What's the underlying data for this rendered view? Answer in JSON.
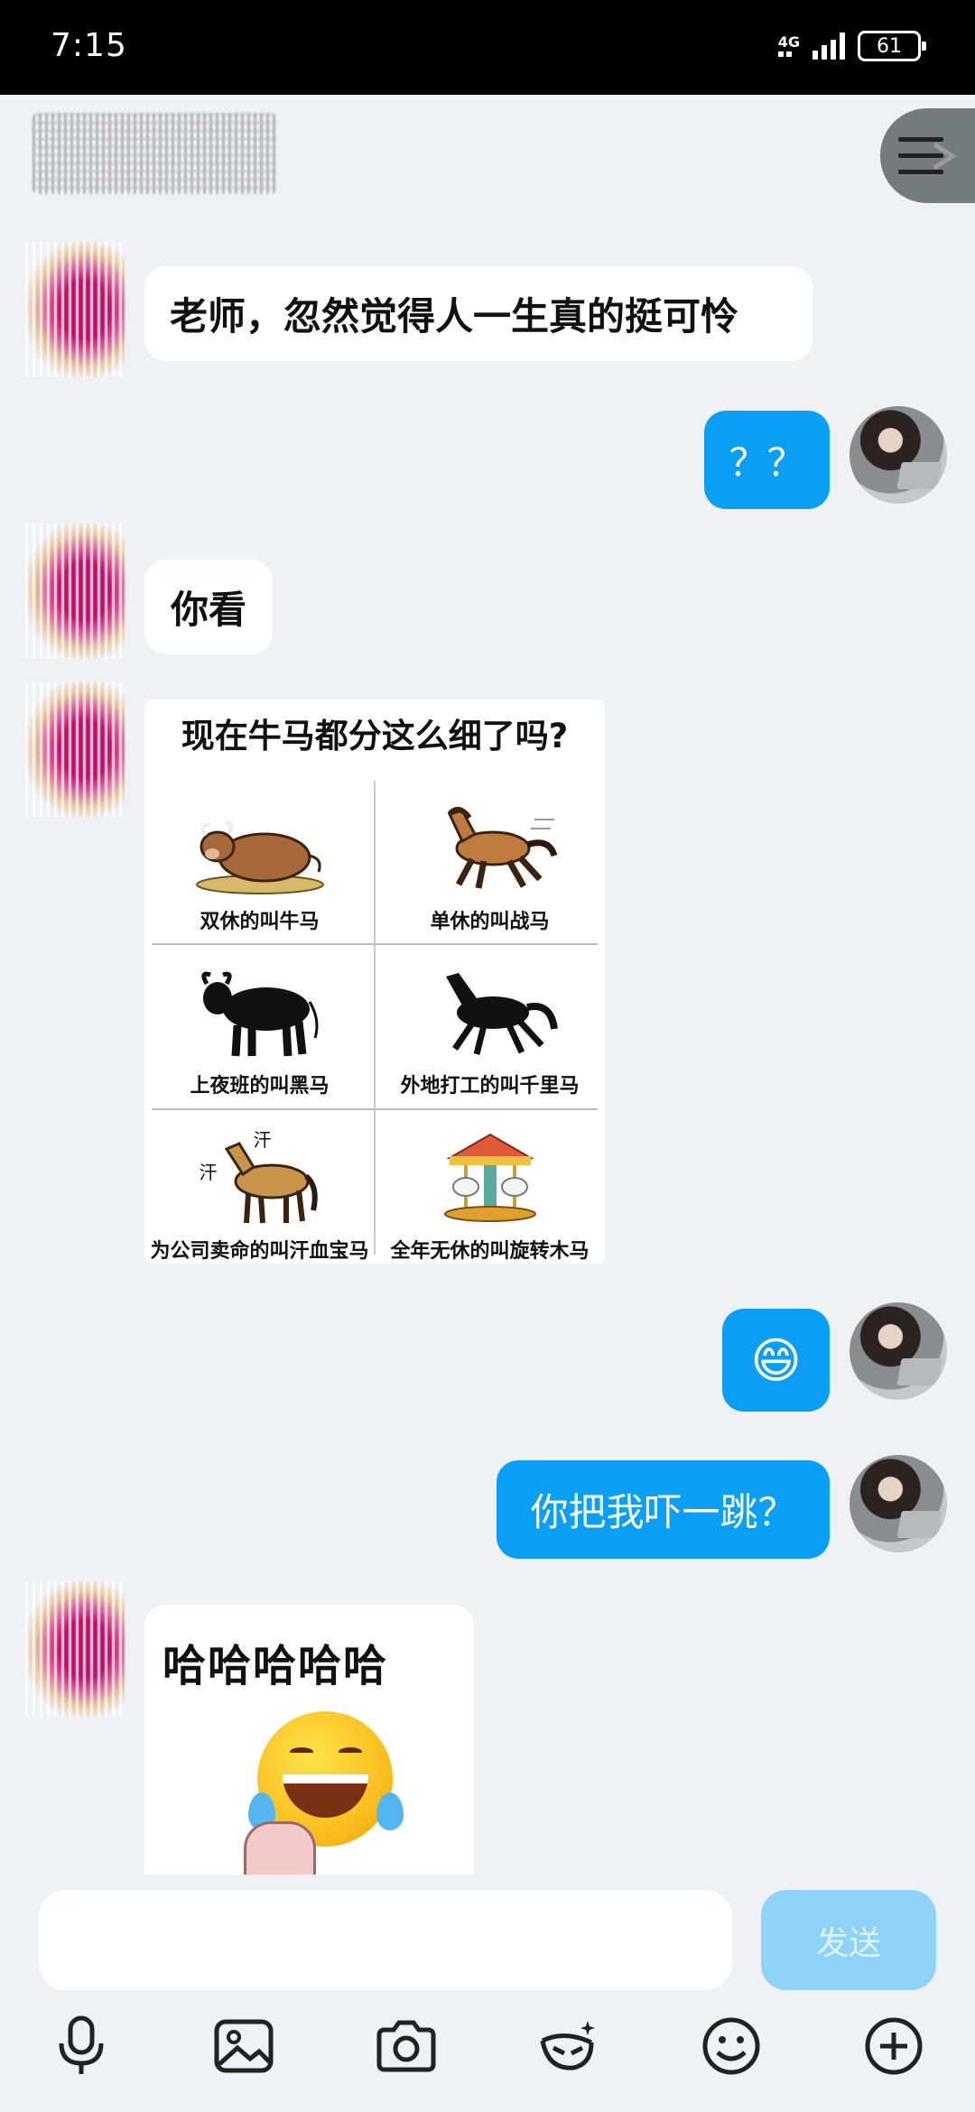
{
  "status_bar": {
    "time": "7:15",
    "network": "4G",
    "battery": "61"
  },
  "header": {
    "contact_name": "",
    "menu_icon": "menu-icon"
  },
  "messages": [
    {
      "side": "left",
      "type": "text",
      "text": "老师，忽然觉得人一生真的挺可怜"
    },
    {
      "side": "right",
      "type": "text",
      "text": "？？"
    },
    {
      "side": "left",
      "type": "text",
      "text": "你看"
    },
    {
      "side": "left",
      "type": "image",
      "title": "现在牛马都分这么细了吗?",
      "captions": [
        "双休的叫牛马",
        "单休的叫战马",
        "上夜班的叫黑马",
        "外地打工的叫千里马",
        "为公司卖命的叫汗血宝马",
        "全年无休的叫旋转木马"
      ],
      "sweat_marks": [
        "汗",
        "汗"
      ]
    },
    {
      "side": "right",
      "type": "emoji",
      "text": "😄"
    },
    {
      "side": "right",
      "type": "text",
      "text": "你把我吓一跳？"
    },
    {
      "side": "left",
      "type": "sticker",
      "text": "哈哈哈哈哈"
    }
  ],
  "composer": {
    "input_value": "",
    "send_label": "发送"
  },
  "toolbar": [
    "microphone-icon",
    "image-icon",
    "camera-icon",
    "magic-emoji-icon",
    "smiley-icon",
    "plus-icon"
  ],
  "colors": {
    "accent": "#0a9ff5",
    "send_disabled": "#8fd2f8",
    "background": "#f0f1f5"
  }
}
